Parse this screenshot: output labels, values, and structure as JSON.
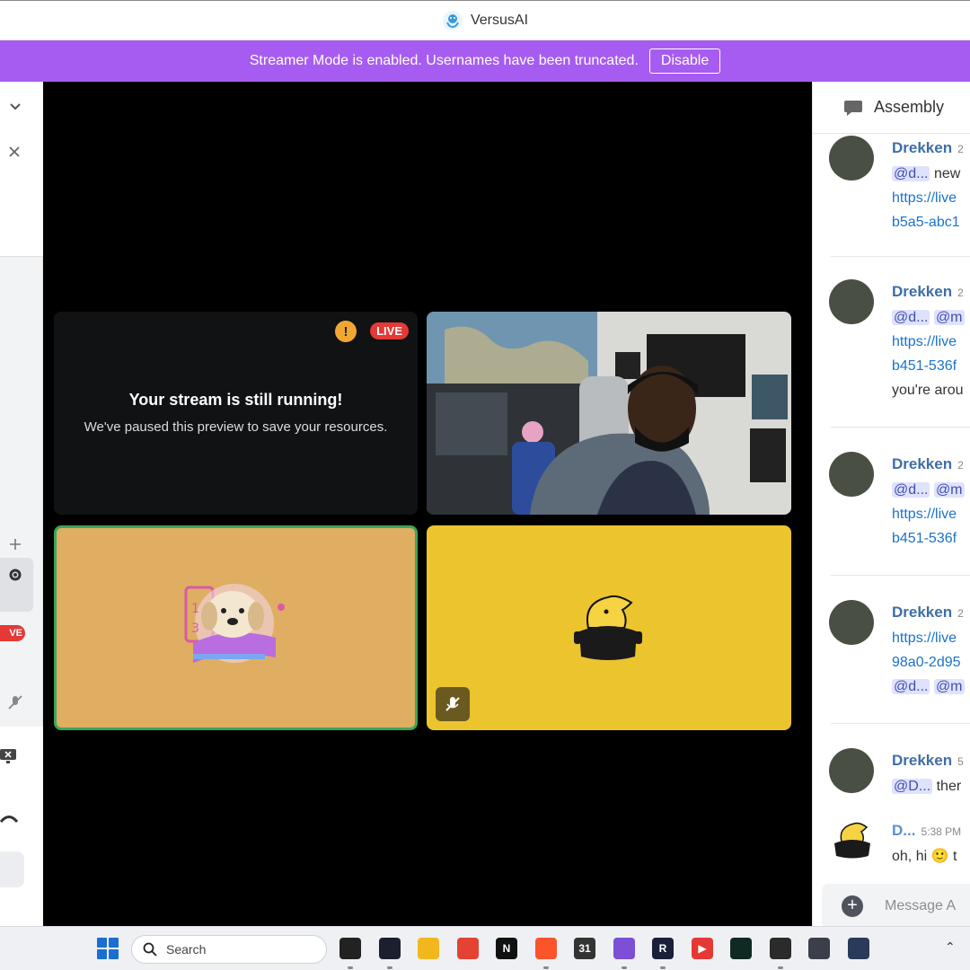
{
  "window": {
    "title": "VersusAI"
  },
  "banner": {
    "message": "Streamer Mode is enabled. Usernames have been truncated.",
    "disable_label": "Disable"
  },
  "stage": {
    "paused_tile": {
      "live_badge": "LIVE",
      "title": "Your stream is still running!",
      "subtitle": "We've paused this preview to save your resources."
    }
  },
  "left_sidebar": {
    "live_badge": "VE"
  },
  "chat": {
    "channel": "Assembly",
    "messages": [
      {
        "author": "Drekken",
        "time": "2",
        "mention": "@d...",
        "line1_text": "new",
        "line2": "https://live",
        "line3": "b5a5-abc1"
      },
      {
        "author": "Drekken",
        "time": "2",
        "mention": "@d...",
        "mention2": "@m",
        "line2": "https://live",
        "line3": "b451-536f",
        "line4": "you're arou"
      },
      {
        "author": "Drekken",
        "time": "2",
        "mention": "@d...",
        "mention2": "@m",
        "line2": "https://live",
        "line3": "b451-536f"
      },
      {
        "author": "Drekken",
        "time": "2",
        "line1": "https://live",
        "line2": "98a0-2d95",
        "mention": "@d...",
        "mention2": "@m"
      },
      {
        "author": "Drekken",
        "time": "5",
        "mention": "@D...",
        "line1_text": "ther"
      },
      {
        "author": "D...",
        "time": "5:38 PM",
        "line1_text": "oh, hi",
        "emoji": "🙂",
        "trail": "t"
      }
    ],
    "composer_placeholder": "Message A"
  },
  "taskbar": {
    "search_placeholder": "Search",
    "apps": [
      {
        "name": "chatgpt",
        "label": "",
        "color": "#222222"
      },
      {
        "name": "versusai",
        "label": "",
        "color": "#1b1f2e"
      },
      {
        "name": "file-explorer",
        "label": "",
        "color": "#f2b71c"
      },
      {
        "name": "todoist",
        "label": "",
        "color": "#e44332"
      },
      {
        "name": "notion",
        "label": "N",
        "color": "#111111"
      },
      {
        "name": "brave",
        "label": "",
        "color": "#fb542b"
      },
      {
        "name": "calendar",
        "label": "31",
        "color": "#333333"
      },
      {
        "name": "obsidian",
        "label": "",
        "color": "#7b4fd6"
      },
      {
        "name": "r-app",
        "label": "R",
        "color": "#1a1f3a"
      },
      {
        "name": "youtube-music",
        "label": "▶",
        "color": "#e53935"
      },
      {
        "name": "terminal-app",
        "label": "",
        "color": "#0f2a23"
      },
      {
        "name": "obs",
        "label": "",
        "color": "#2b2b2b"
      },
      {
        "name": "calculator",
        "label": "",
        "color": "#3a3f4a"
      },
      {
        "name": "photo-app",
        "label": "",
        "color": "#2a3a5a"
      }
    ]
  }
}
